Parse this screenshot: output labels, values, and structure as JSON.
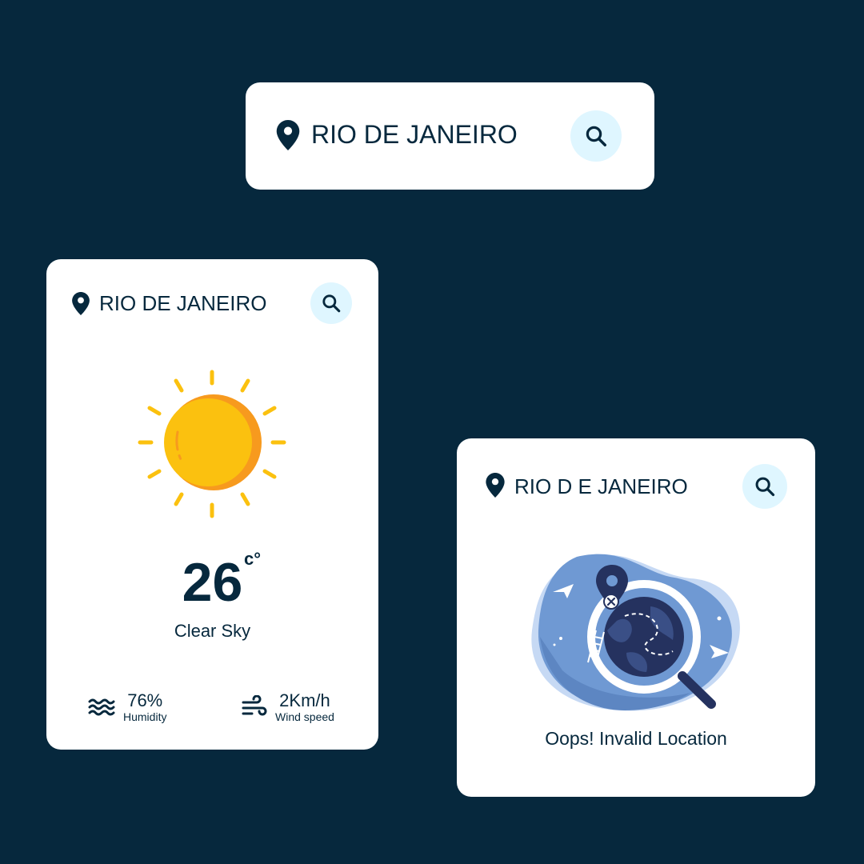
{
  "top_search": {
    "location": "RIO DE JANEIRO"
  },
  "weather_card": {
    "location": "RIO DE JANEIRO",
    "temperature": "26",
    "unit": "c°",
    "condition": "Clear Sky",
    "humidity": {
      "value": "76%",
      "label": "Humidity"
    },
    "wind": {
      "value": "2Km/h",
      "label": "Wind speed"
    }
  },
  "error_card": {
    "location": "RIO D E JANEIRO",
    "message": "Oops! Invalid Location"
  },
  "colors": {
    "background": "#06283d",
    "card": "#ffffff",
    "text": "#06283d",
    "search_button": "#dff6ff",
    "sun": "#fbc10f",
    "sun_shadow": "#f79a1e"
  },
  "icons": [
    "location-pin-icon",
    "search-icon",
    "sun-icon",
    "humidity-icon",
    "wind-icon",
    "invalid-location-illustration"
  ]
}
